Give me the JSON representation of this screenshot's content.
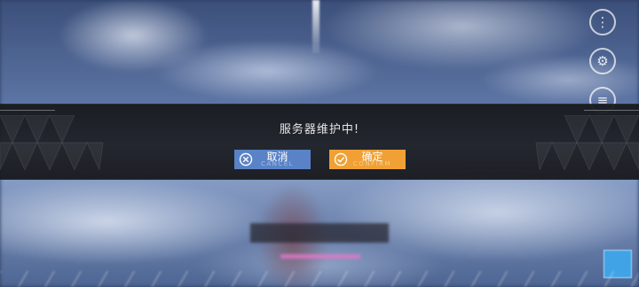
{
  "dialog": {
    "message": "服务器维护中!",
    "cancel": {
      "label": "取消",
      "sub_label": "CANCEL"
    },
    "confirm": {
      "label": "确定",
      "sub_label": "CONFIRM"
    }
  },
  "colors": {
    "cancel_button": "#5a82c6",
    "confirm_button": "#f0a034",
    "modal_band": "#1c1e22"
  },
  "icons": [
    "x-circle-icon",
    "check-circle-icon"
  ]
}
